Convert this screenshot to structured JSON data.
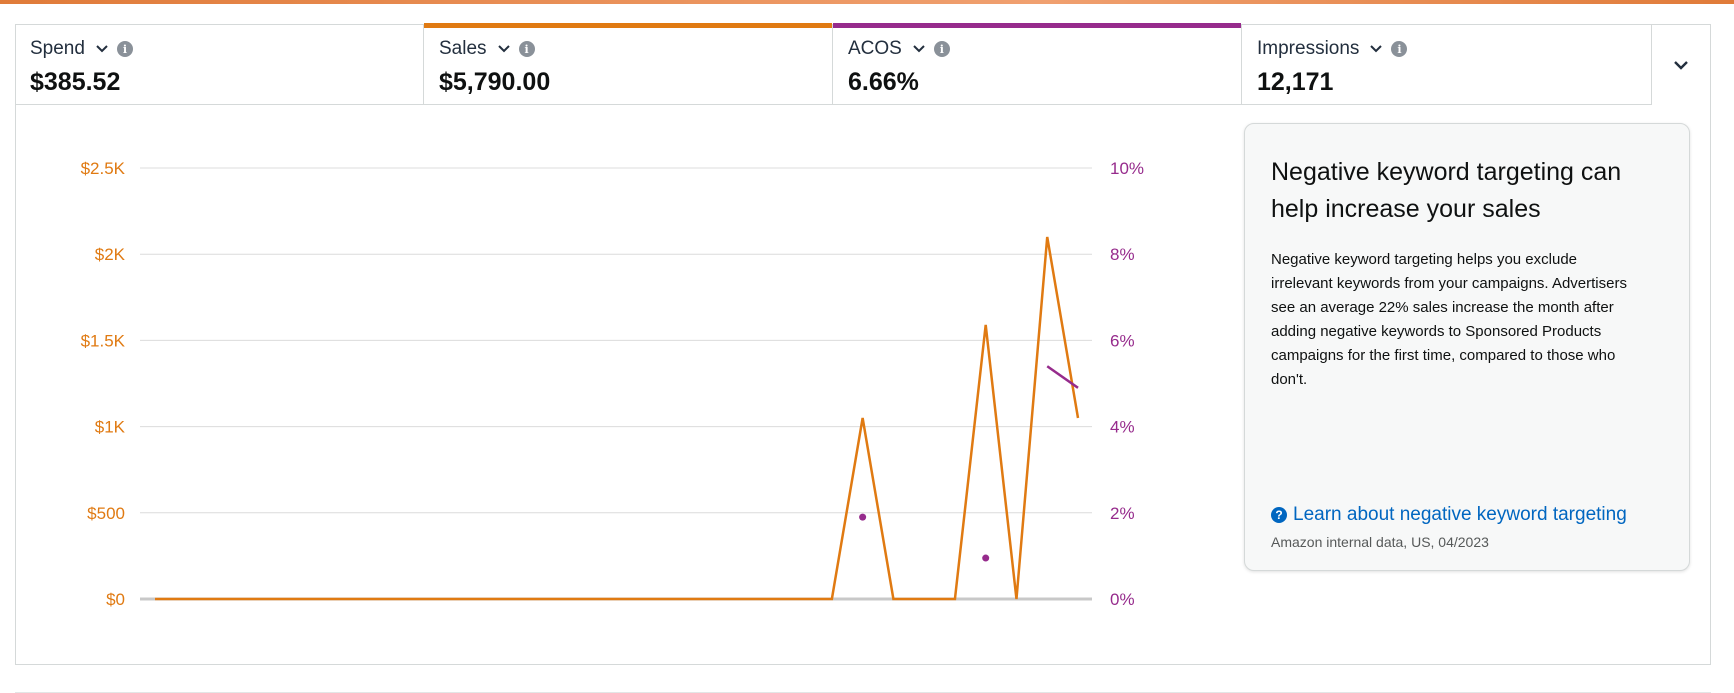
{
  "metrics": [
    {
      "label": "Spend",
      "value": "$385.52",
      "accent": ""
    },
    {
      "label": "Sales",
      "value": "$5,790.00",
      "accent": "#e07a12"
    },
    {
      "label": "ACOS",
      "value": "6.66%",
      "accent": "#962b8c"
    },
    {
      "label": "Impressions",
      "value": "12,171",
      "accent": ""
    }
  ],
  "info_glyph": "i",
  "tip": {
    "title": "Negative keyword targeting can help increase your sales",
    "body": "Negative keyword targeting helps you exclude irrelevant keywords from your campaigns. Advertisers see an average 22% sales increase the month after adding negative keywords to Sponsored Products campaigns for the first time, compared to those who don't.",
    "link": "Learn about negative keyword targeting",
    "link_icon": "?",
    "source": "Amazon internal data, US, 04/2023"
  },
  "colors": {
    "sales": "#e07a12",
    "acos": "#962b8c",
    "link": "#0066c0",
    "grid": "#dcdcdc"
  },
  "chart_data": {
    "type": "line",
    "left_axis": {
      "label": "",
      "ticks": [
        "$0",
        "$500",
        "$1K",
        "$1.5K",
        "$2K",
        "$2.5K"
      ],
      "ylim": [
        0,
        2500
      ]
    },
    "right_axis": {
      "label": "",
      "ticks": [
        "0%",
        "2%",
        "4%",
        "6%",
        "8%",
        "10%"
      ],
      "ylim": [
        0,
        10
      ]
    },
    "x_count": 31,
    "series": [
      {
        "name": "Sales",
        "axis": "left",
        "color": "#e07a12",
        "values": [
          0,
          0,
          0,
          0,
          0,
          0,
          0,
          0,
          0,
          0,
          0,
          0,
          0,
          0,
          0,
          0,
          0,
          0,
          0,
          0,
          0,
          0,
          0,
          1050,
          0,
          0,
          0,
          1590,
          0,
          2100,
          1050
        ]
      },
      {
        "name": "ACOS",
        "axis": "right",
        "color": "#962b8c",
        "values": [
          null,
          null,
          null,
          null,
          null,
          null,
          null,
          null,
          null,
          null,
          null,
          null,
          null,
          null,
          null,
          null,
          null,
          null,
          null,
          null,
          null,
          null,
          null,
          1.9,
          null,
          null,
          null,
          0.95,
          null,
          5.4,
          4.9
        ]
      }
    ]
  }
}
